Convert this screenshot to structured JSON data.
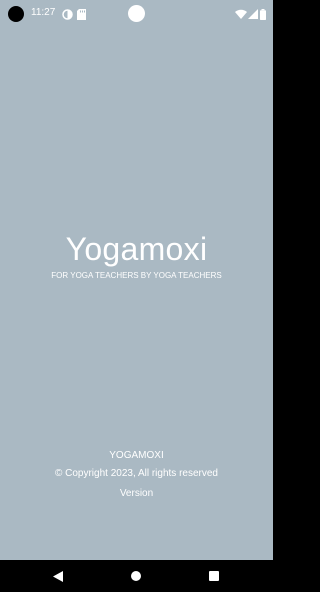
{
  "status_bar": {
    "time": "11:27",
    "icons": [
      "camera-cutout-icon",
      "do-not-disturb-icon",
      "sd-card-icon",
      "wifi-icon",
      "cellular-signal-icon",
      "battery-icon"
    ]
  },
  "splash": {
    "title": "Yogamoxi",
    "tagline": "FOR YOGA TEACHERS BY YOGA TEACHERS"
  },
  "footer": {
    "brand": "YOGAMOXI",
    "copyright": "© Copyright 2023, All rights reserved",
    "version": "Version"
  },
  "nav_bar": {
    "icons": [
      "back-icon",
      "home-icon",
      "recents-icon"
    ]
  },
  "colors": {
    "background": "#aab9c3",
    "text": "#ffffff",
    "system_bar": "#000000"
  }
}
